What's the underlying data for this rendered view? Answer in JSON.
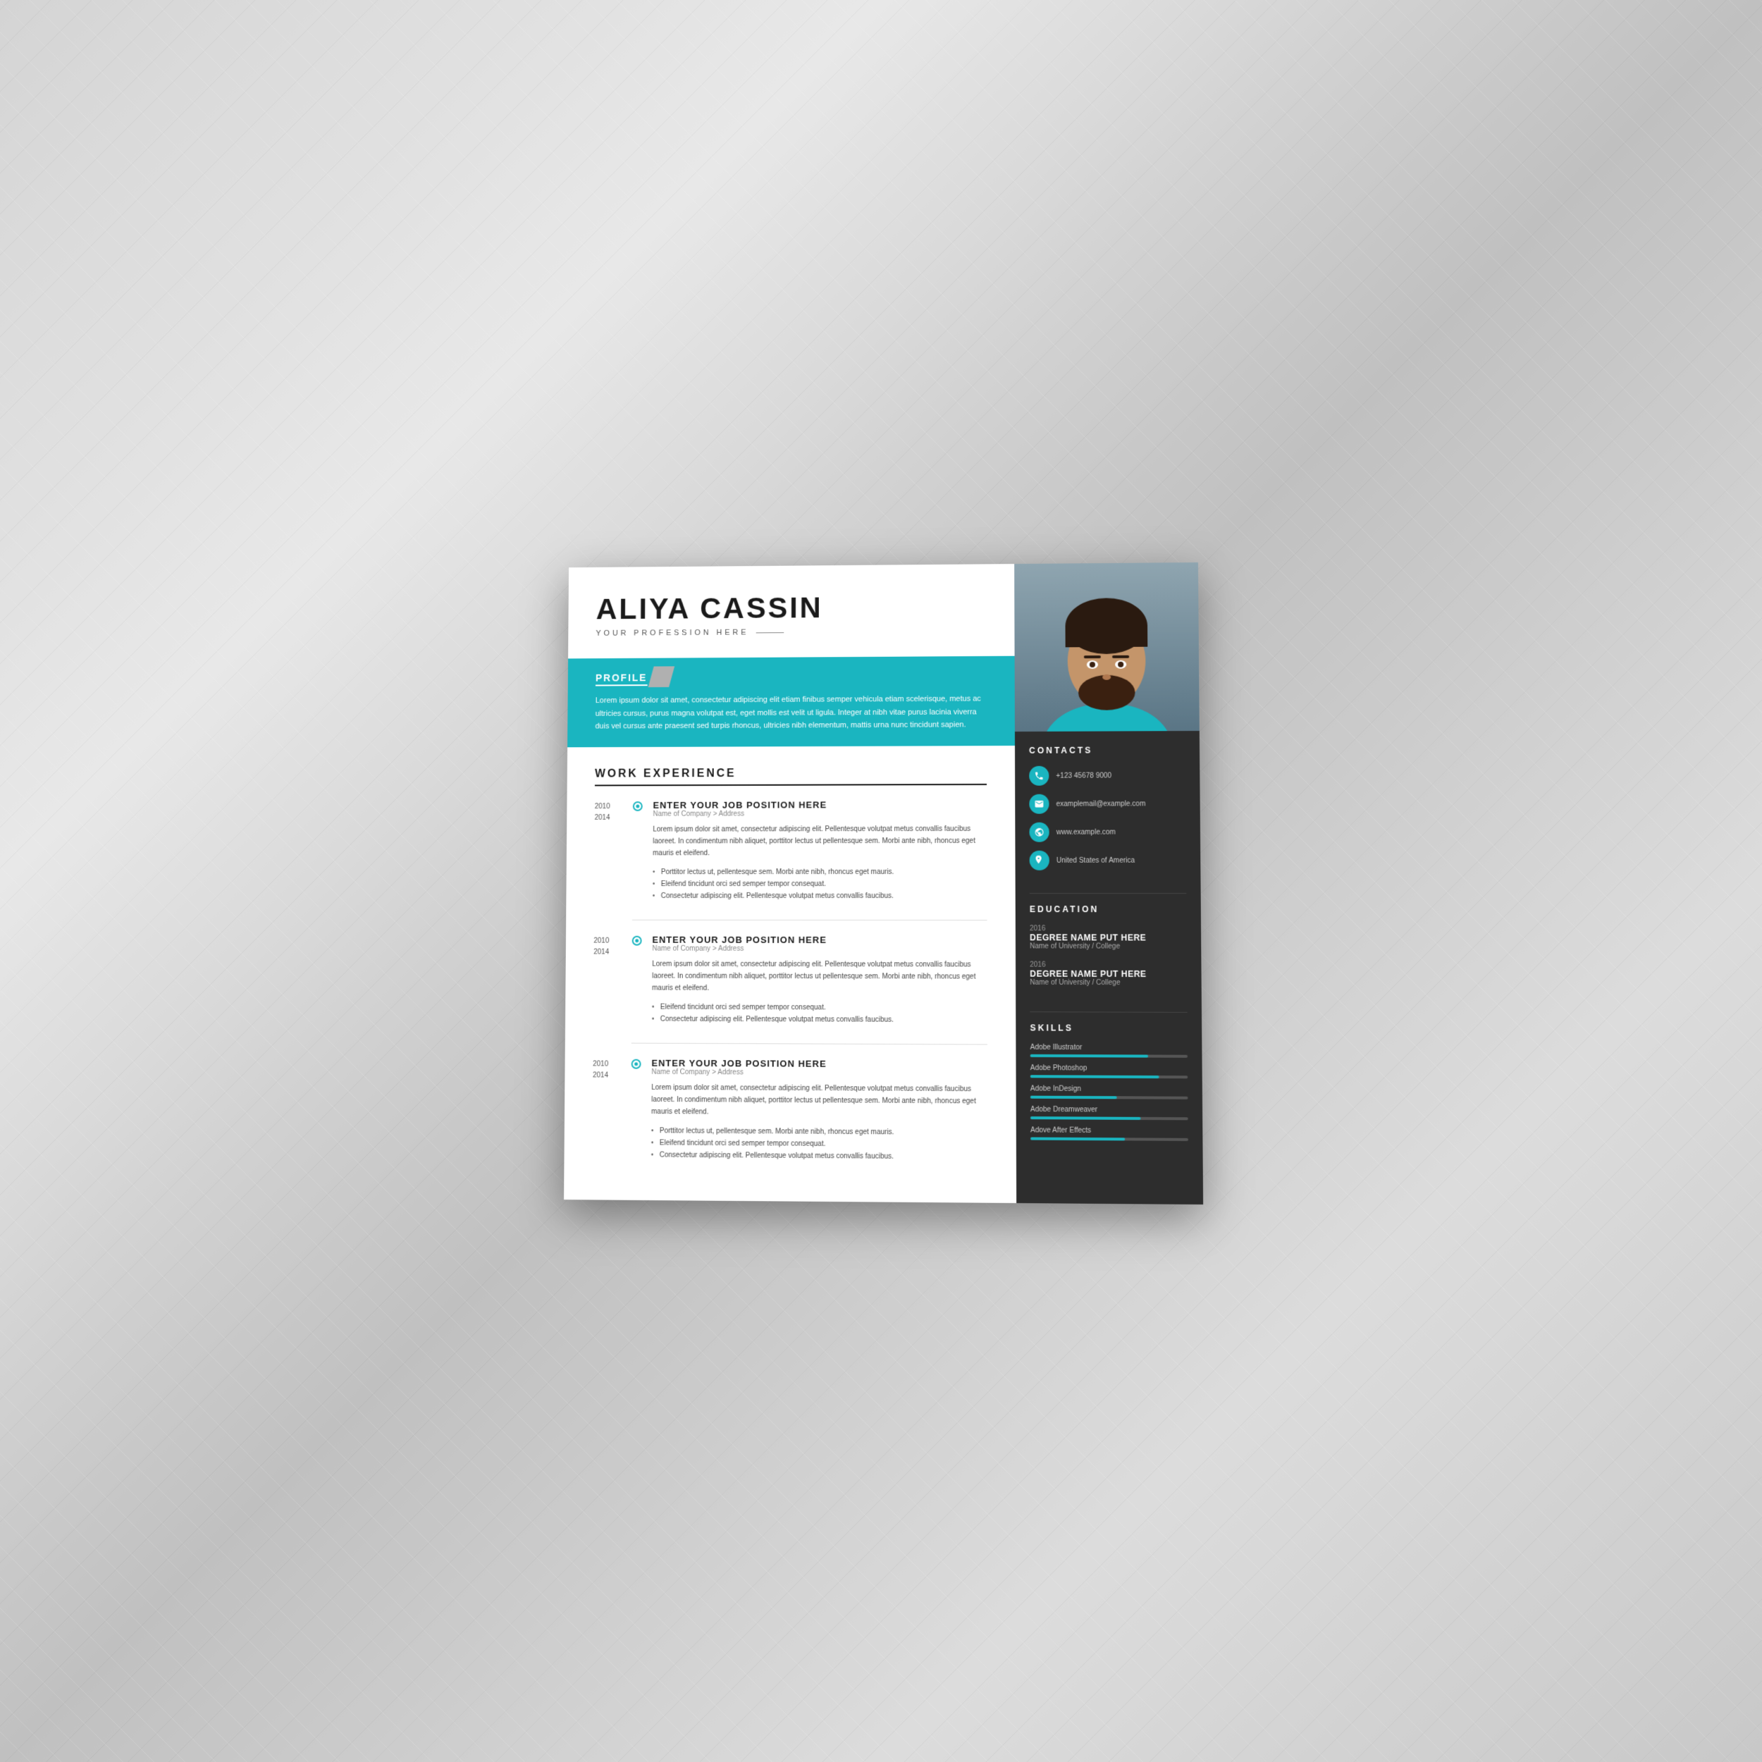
{
  "resume": {
    "name": "ALIYA CASSIN",
    "profession": "YOUR PROFESSION HERE",
    "profile": {
      "label": "PROFILE",
      "text": "Lorem ipsum dolor sit amet, consectetur adipiscing elit etiam finibus semper vehicula etiam scelerisque, metus ac ultricies cursus, purus magna volutpat est, eget mollis est velit ut ligula. Integer at nibh vitae purus lacinia viverra duis vel cursus ante praesent sed turpis rhoncus, ultricies nibh elementum, mattis urna nunc tincidunt sapien."
    },
    "work_experience": {
      "title": "WORK EXPERIENCE",
      "jobs": [
        {
          "year_start": "2010",
          "year_end": "2014",
          "title": "ENTER YOUR JOB POSITION HERE",
          "company": "Name of Company > Address",
          "description": "Lorem ipsum dolor sit amet, consectetur adipiscing elit. Pellentesque volutpat metus convallis faucibus laoreet. In condimentum nibh aliquet, porttitor lectus ut pellentesque sem. Morbi ante nibh, rhoncus eget mauris et eleifend.",
          "bullets": [
            "Porttitor lectus ut, pellentesque sem. Morbi ante nibh, rhoncus eget mauris.",
            "Eleifend tincidunt orci sed semper tempor consequat.",
            "Consectetur adipiscing elit. Pellentesque volutpat metus convallis faucibus."
          ]
        },
        {
          "year_start": "2010",
          "year_end": "2014",
          "title": "ENTER YOUR JOB POSITION HERE",
          "company": "Name of Company > Address",
          "description": "Lorem ipsum dolor sit amet, consectetur adipiscing elit. Pellentesque volutpat metus convallis faucibus laoreet. In condimentum nibh aliquet, porttitor lectus ut pellentesque sem. Morbi ante nibh, rhoncus eget mauris et eleifend.",
          "bullets": [
            "Eleifend tincidunt orci sed semper tempor consequat.",
            "Consectetur adipiscing elit. Pellentesque volutpat metus convallis faucibus."
          ]
        },
        {
          "year_start": "2010",
          "year_end": "2014",
          "title": "ENTER YOUR JOB POSITION HERE",
          "company": "Name of Company > Address",
          "description": "Lorem ipsum dolor sit amet, consectetur adipiscing elit. Pellentesque volutpat metus convallis faucibus laoreet. In condimentum nibh aliquet, porttitor lectus ut pellentesque sem. Morbi ante nibh, rhoncus eget mauris et eleifend.",
          "bullets": [
            "Porttitor lectus ut, pellentesque sem. Morbi ante nibh, rhoncus eget mauris.",
            "Eleifend tincidunt orci sed semper tempor consequat.",
            "Consectetur adipiscing elit. Pellentesque volutpat metus convallis faucibus."
          ]
        }
      ]
    },
    "contacts": {
      "title": "CONTACTS",
      "items": [
        {
          "icon": "phone",
          "text": "+123 45678 9000"
        },
        {
          "icon": "email",
          "text": "examplemail@example.com"
        },
        {
          "icon": "web",
          "text": "www.example.com"
        },
        {
          "icon": "location",
          "text": "United States of America"
        }
      ]
    },
    "education": {
      "title": "EDUCATION",
      "entries": [
        {
          "year": "2016",
          "degree": "DEGREE NAME PUT HERE",
          "school": "Name of University / College"
        },
        {
          "year": "2016",
          "degree": "DEGREE NAME PUT HERE",
          "school": "Name of University / College"
        }
      ]
    },
    "skills": {
      "title": "SKILLS",
      "items": [
        {
          "name": "Adobe Illustrator",
          "percent": 75
        },
        {
          "name": "Adobe Photoshop",
          "percent": 82
        },
        {
          "name": "Adobe InDesign",
          "percent": 55
        },
        {
          "name": "Adobe Dreamweaver",
          "percent": 70
        },
        {
          "name": "Adove After Effects",
          "percent": 60
        }
      ]
    }
  },
  "colors": {
    "teal": "#1ab5c0",
    "dark": "#2d2d2d",
    "white": "#ffffff"
  }
}
